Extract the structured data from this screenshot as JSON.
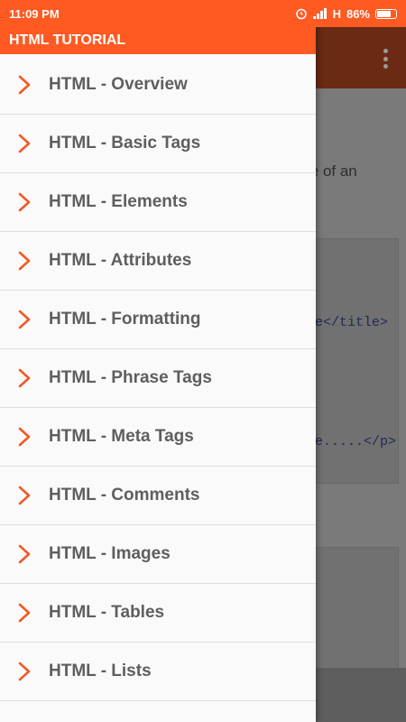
{
  "status": {
    "time": "11:09 PM",
    "network": "H",
    "battery": "86%",
    "battery_level": 0.86
  },
  "drawer": {
    "title": "HTML TUTORIAL",
    "items": [
      {
        "label": "HTML - Overview"
      },
      {
        "label": "HTML - Basic Tags"
      },
      {
        "label": "HTML - Elements"
      },
      {
        "label": "HTML - Attributes"
      },
      {
        "label": "HTML - Formatting"
      },
      {
        "label": "HTML - Phrase Tags"
      },
      {
        "label": "HTML - Meta Tags"
      },
      {
        "label": "HTML - Comments"
      },
      {
        "label": "HTML - Images"
      },
      {
        "label": "HTML - Tables"
      },
      {
        "label": "HTML - Lists"
      }
    ]
  },
  "background": {
    "text_fragment": "le of an",
    "code_fragment_1": "e</title>",
    "code_fragment_2": "e.....</p>"
  },
  "colors": {
    "accent": "#ff5a22",
    "chevron": "#f05a24",
    "label": "#5e5e5e"
  }
}
